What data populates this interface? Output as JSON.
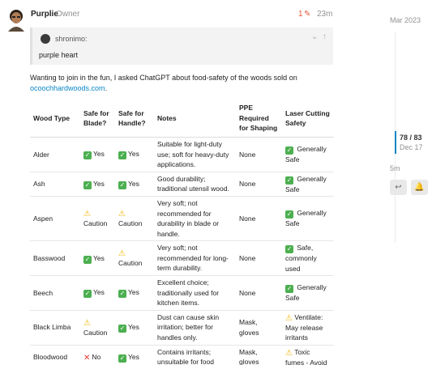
{
  "post": {
    "username": "Purplie",
    "user_title": "Owner",
    "edit_count": "1",
    "time": "23m",
    "quote": {
      "user": "shronimo:",
      "text": "purple heart"
    },
    "intro_text": "Wanting to join in the fun, I asked ChatGPT about food-safety of the woods sold on",
    "intro_link": "ocoochhardwoods.com",
    "intro_end": "."
  },
  "table": {
    "headers": {
      "wood": "Wood Type",
      "blade": "Safe for Blade?",
      "handle": "Safe for Handle?",
      "notes": "Notes",
      "ppe": "PPE Required for Shaping",
      "laser": "Laser Cutting Safety"
    },
    "rows": [
      {
        "wood": "Alder",
        "blade": "Yes",
        "handle": "Yes",
        "notes": "Suitable for light-duty use; soft for heavy-duty applications.",
        "ppe": "None",
        "laser": "Generally Safe"
      },
      {
        "wood": "Ash",
        "blade": "Yes",
        "handle": "Yes",
        "notes": "Good durability; traditional utensil wood.",
        "ppe": "None",
        "laser": "Generally Safe"
      },
      {
        "wood": "Aspen",
        "blade": "Caution",
        "handle": "Caution",
        "notes": "Very soft; not recommended for durability in blade or handle.",
        "ppe": "None",
        "laser": "Generally Safe"
      },
      {
        "wood": "Basswood",
        "blade": "Yes",
        "handle": "Caution",
        "notes": "Very soft; not recommended for long-term durability.",
        "ppe": "None",
        "laser": "Safe, commonly used"
      },
      {
        "wood": "Beech",
        "blade": "Yes",
        "handle": "Yes",
        "notes": "Excellent choice; traditionally used for kitchen items.",
        "ppe": "None",
        "laser": "Generally Safe"
      },
      {
        "wood": "Black Limba",
        "blade": "Caution",
        "handle": "Yes",
        "notes": "Dust can cause skin irritation; better for handles only.",
        "ppe": "Mask, gloves",
        "laser": "Ventilate: May release irritants"
      },
      {
        "wood": "Bloodwood",
        "blade": "No",
        "handle": "Yes",
        "notes": "Contains irritants; unsuitable for food",
        "ppe": "Mask, gloves",
        "laser": "Toxic fumes - Avoid"
      }
    ]
  },
  "timeline": {
    "top_date": "Mar 2023",
    "counter": "78 / 83",
    "date": "Dec 17",
    "ago": "5m"
  },
  "icons": {
    "ok": "check-mark-button-icon",
    "caution": "warning-icon",
    "no": "cross-mark-icon",
    "edit": "pencil-icon",
    "back": "back-arrow-icon",
    "bell": "bell-icon"
  },
  "colors": {
    "link": "#0a86c6",
    "accent": "#e45735",
    "ok": "#4caf50",
    "warn": "#f2b600",
    "no": "#e53935"
  }
}
